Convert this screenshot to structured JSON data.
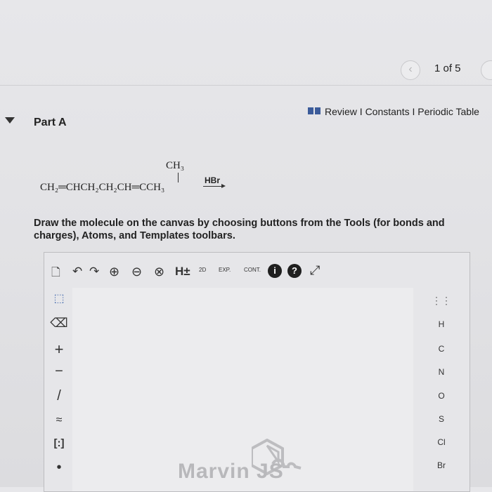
{
  "pager": {
    "prev_glyph": "‹",
    "count_text": "1 of 5"
  },
  "toplinks": {
    "text": "Review I Constants I Periodic Table"
  },
  "part": {
    "label": "Part A"
  },
  "reaction": {
    "substituent": "CH₃",
    "main": "CH₂═CHCH₂CH₂CH═CCH₃",
    "reagent": "HBr"
  },
  "instructions": "Draw the molecule on the canvas by choosing buttons from the Tools (for bonds and charges), Atoms, and Templates toolbars.",
  "toolbar": {
    "items": [
      {
        "name": "new-document-icon",
        "glyph": "🗋"
      },
      {
        "name": "undo-icon",
        "glyph": "↶"
      },
      {
        "name": "redo-icon",
        "glyph": "↷"
      },
      {
        "name": "zoom-in-icon",
        "glyph": "⊕"
      },
      {
        "name": "zoom-out-icon",
        "glyph": "⊖"
      },
      {
        "name": "clear-icon",
        "glyph": "⊗"
      },
      {
        "name": "hydrogen-toggle",
        "glyph": "H±"
      },
      {
        "name": "clean-2d-icon",
        "glyph": "2D"
      },
      {
        "name": "expand-icon",
        "glyph": "EXP."
      },
      {
        "name": "contract-icon",
        "glyph": "CONT."
      },
      {
        "name": "info-icon",
        "glyph": "i"
      },
      {
        "name": "help-icon",
        "glyph": "?"
      },
      {
        "name": "fullscreen-icon",
        "glyph": "⤢"
      }
    ]
  },
  "left_tools": [
    {
      "name": "select-tool",
      "glyph": "⬚"
    },
    {
      "name": "erase-tool",
      "glyph": "⌫"
    },
    {
      "name": "charge-plus-tool",
      "glyph": "+"
    },
    {
      "name": "charge-minus-tool",
      "glyph": "−"
    },
    {
      "name": "single-bond-tool",
      "glyph": "/"
    },
    {
      "name": "chain-tool",
      "glyph": "≈"
    },
    {
      "name": "bracket-tool",
      "glyph": "[:]"
    },
    {
      "name": "electron-tool",
      "glyph": "•"
    }
  ],
  "atoms": {
    "periodic": "⋮⋮",
    "list": [
      "H",
      "C",
      "N",
      "O",
      "S",
      "Cl",
      "Br"
    ]
  },
  "canvas": {
    "watermark": "Marvin JS"
  },
  "colors": {
    "accent": "#3b5b9a",
    "info": "#1f1f1f"
  }
}
